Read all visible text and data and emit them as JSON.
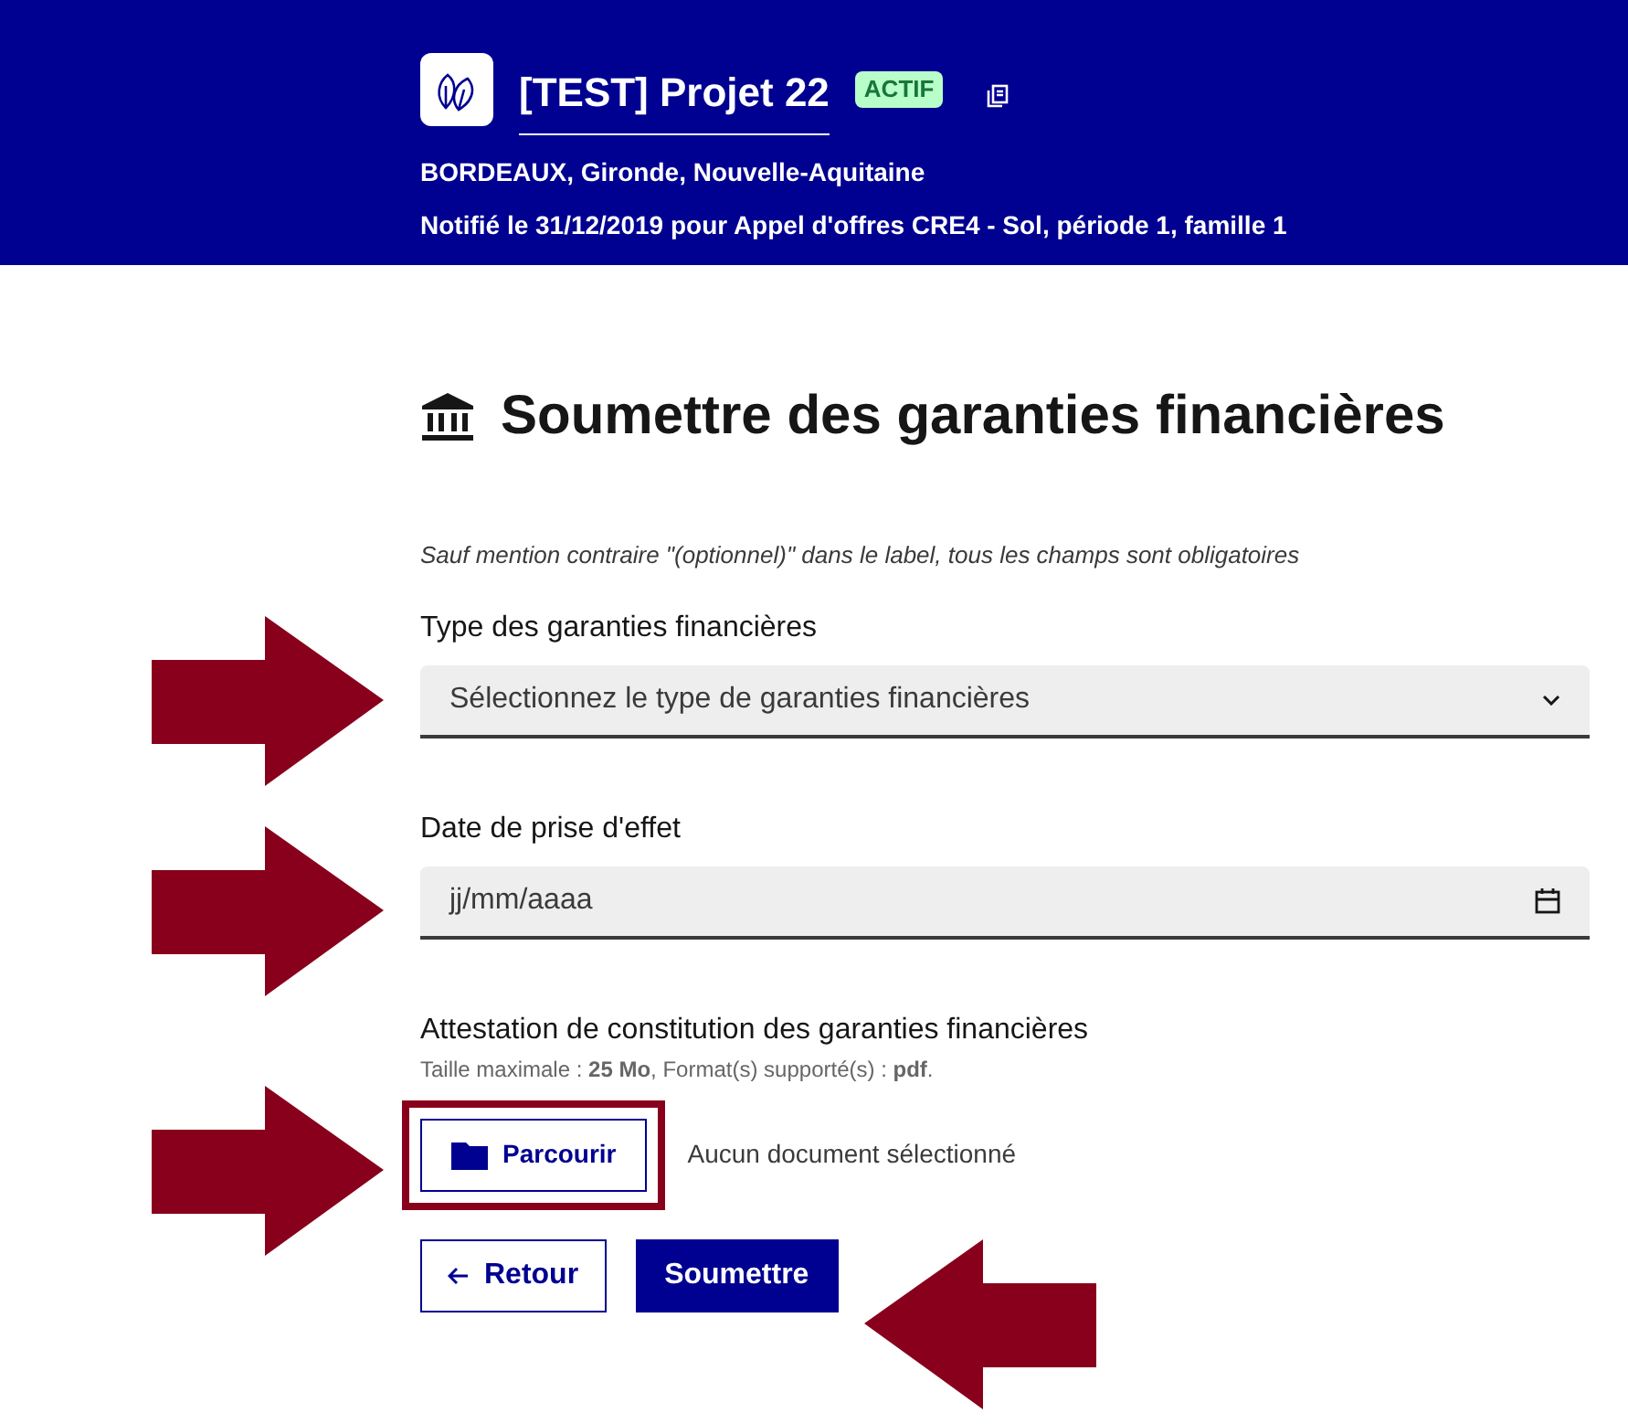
{
  "header": {
    "title": "[TEST] Projet 22",
    "badge": "ACTIF",
    "location": "BORDEAUX, Gironde, Nouvelle-Aquitaine",
    "notification": "Notifié le 31/12/2019 pour Appel d'offres CRE4 - Sol, période 1, famille 1"
  },
  "page_title": "Soumettre des garanties financières",
  "required_notice": "Sauf mention contraire \"(optionnel)\" dans le label, tous les champs sont obligatoires",
  "fields": [
    {
      "kind": "select",
      "label": "Type des garanties financières",
      "placeholder": "Sélectionnez le type de garanties financières"
    },
    {
      "kind": "date",
      "label": "Date de prise d'effet",
      "placeholder": "jj/mm/aaaa"
    },
    {
      "kind": "file",
      "label": "Attestation de constitution des garanties financières",
      "hint": "Taille maximale : **25 Mo**, Format(s) supporté(s) : **pdf**.",
      "button": "Parcourir",
      "status": "Aucun document sélectionné"
    }
  ],
  "buttons": [
    {
      "kind": "secondary",
      "label": "Retour"
    },
    {
      "kind": "primary",
      "label": "Soumettre"
    }
  ]
}
